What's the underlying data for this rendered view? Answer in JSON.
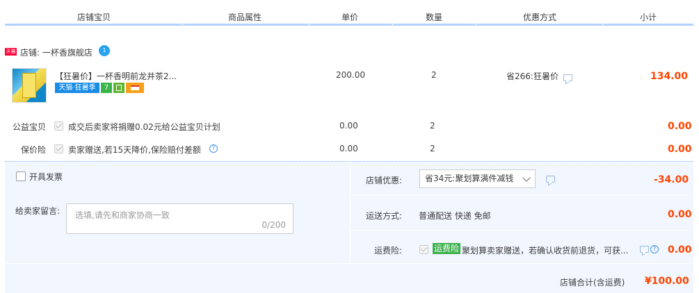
{
  "header": {
    "col_shop_item": "店铺宝贝",
    "col_attrs": "商品属性",
    "col_price": "单价",
    "col_qty": "数量",
    "col_discount": "优惠方式",
    "col_subtotal": "小计"
  },
  "shop": {
    "tag": "天猫",
    "name": "店铺: 一杯香旗舰店",
    "wangwang_icon": "wangwang-chat-icon"
  },
  "product": {
    "title": "【狂暑价】一杯香明前龙井茶2...",
    "badges": [
      "天猫·狂暑季",
      "7",
      "",
      ""
    ],
    "price": "200.00",
    "qty": "2",
    "discount": "省266:狂暑价",
    "subtotal": "134.00"
  },
  "charity": {
    "label": "公益宝贝",
    "text": "成交后卖家将捐赠0.02元给公益宝贝计划",
    "price": "0.00",
    "qty": "2",
    "subtotal": "0.00"
  },
  "price_protection": {
    "label": "保价险",
    "text": "卖家赠送,若15天降价,保险赔付差额",
    "price": "0.00",
    "qty": "2",
    "subtotal": "0.00"
  },
  "invoice": {
    "label": "开具发票"
  },
  "message": {
    "label": "给卖家留言:",
    "placeholder": "选填,请先和商家协商一致",
    "count": "0/200"
  },
  "shop_discount": {
    "label": "店铺优惠:",
    "selected": "省34元:聚划算满件减钱",
    "amount": "-34.00"
  },
  "shipping": {
    "label": "运送方式:",
    "value": "普通配送 快递 免邮",
    "amount": "0.00"
  },
  "shipping_insurance": {
    "label": "运费险:",
    "badge": "运费险",
    "text": "聚划算卖家赠送，若确认收货前退货，可获...",
    "amount": "0.00"
  },
  "total": {
    "label": "店铺合计(含运费)",
    "amount": "¥100.00"
  },
  "colors": {
    "accent_red": "#ff4400",
    "header_line": "#b2d1ff",
    "panel_bg": "#f2f7ff",
    "tmall_red": "#ff0036"
  }
}
